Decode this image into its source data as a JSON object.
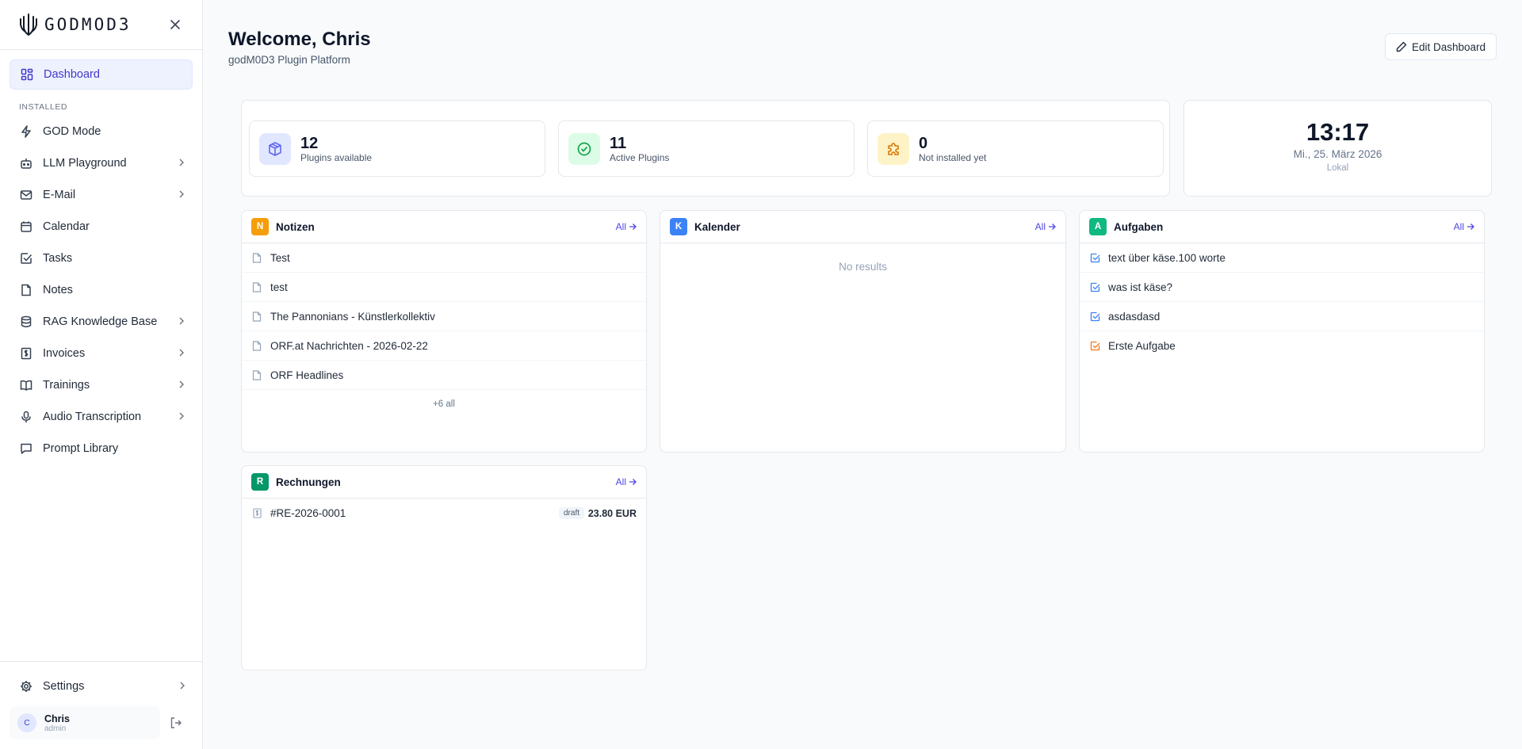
{
  "app": {
    "logo_text": "GODMOD3"
  },
  "sidebar": {
    "active": "Dashboard",
    "dashboard_label": "Dashboard",
    "section_label": "INSTALLED",
    "items": [
      {
        "label": "GOD Mode",
        "icon": "lightning-icon",
        "has_children": false
      },
      {
        "label": "LLM Playground",
        "icon": "bot-icon",
        "has_children": true
      },
      {
        "label": "E-Mail",
        "icon": "mail-icon",
        "has_children": true
      },
      {
        "label": "Calendar",
        "icon": "calendar-icon",
        "has_children": false
      },
      {
        "label": "Tasks",
        "icon": "checkbox-icon",
        "has_children": false
      },
      {
        "label": "Notes",
        "icon": "file-icon",
        "has_children": false
      },
      {
        "label": "RAG Knowledge Base",
        "icon": "database-icon",
        "has_children": true
      },
      {
        "label": "Invoices",
        "icon": "receipt-icon",
        "has_children": true
      },
      {
        "label": "Trainings",
        "icon": "book-icon",
        "has_children": true
      },
      {
        "label": "Audio Transcription",
        "icon": "mic-icon",
        "has_children": true
      },
      {
        "label": "Prompt Library",
        "icon": "message-icon",
        "has_children": false
      }
    ],
    "settings_label": "Settings",
    "user": {
      "initial": "C",
      "name": "Chris",
      "role": "admin"
    }
  },
  "header": {
    "title": "Welcome, Chris",
    "subtitle": "godM0D3 Plugin Platform",
    "edit_button": "Edit Dashboard"
  },
  "stats": [
    {
      "value": "12",
      "label": "Plugins available",
      "icon": "package-icon",
      "color": "#6366f1",
      "bg": "#e0e7ff"
    },
    {
      "value": "11",
      "label": "Active Plugins",
      "icon": "check-circle-icon",
      "color": "#16a34a",
      "bg": "#dcfce7"
    },
    {
      "value": "0",
      "label": "Not installed yet",
      "icon": "puzzle-icon",
      "color": "#d97706",
      "bg": "#fef3c7"
    }
  ],
  "clock": {
    "time": "13:17",
    "date": "Mi., 25. März 2026",
    "zone": "Lokal"
  },
  "widgets": {
    "notes": {
      "badge": "N",
      "color": "#f59e0b",
      "title": "Notizen",
      "all_label": "All",
      "items": [
        "Test",
        "test",
        "The Pannonians - Künstlerkollektiv",
        "ORF.at Nachrichten - 2026-02-22",
        "ORF Headlines"
      ],
      "more": "+6 all"
    },
    "calendar": {
      "badge": "K",
      "color": "#3b82f6",
      "title": "Kalender",
      "all_label": "All",
      "empty": "No results"
    },
    "tasks": {
      "badge": "A",
      "color": "#10b981",
      "title": "Aufgaben",
      "all_label": "All",
      "items": [
        {
          "label": "text über käse.100 worte",
          "color": "#3b82f6"
        },
        {
          "label": "was ist käse?",
          "color": "#3b82f6"
        },
        {
          "label": "asdasdasd",
          "color": "#3b82f6"
        },
        {
          "label": "Erste Aufgabe",
          "color": "#f97316"
        }
      ]
    },
    "invoices": {
      "badge": "R",
      "color": "#059669",
      "title": "Rechnungen",
      "all_label": "All",
      "items": [
        {
          "number": "#RE-2026-0001",
          "status": "draft",
          "amount": "23.80 EUR"
        }
      ]
    }
  }
}
